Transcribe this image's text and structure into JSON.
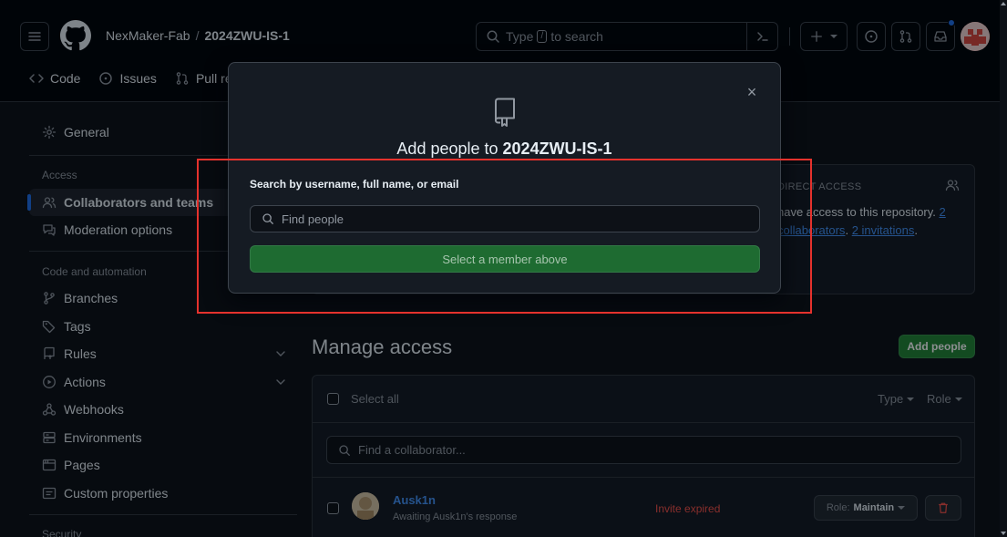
{
  "header": {
    "owner": "NexMaker-Fab",
    "separator": "/",
    "repo": "2024ZWU-IS-1",
    "search": {
      "prefix": "Type",
      "key": "/",
      "suffix": "to search"
    },
    "tabs": [
      {
        "label": "Code",
        "icon": "code-icon"
      },
      {
        "label": "Issues",
        "icon": "issue-icon"
      },
      {
        "label": "Pull re",
        "icon": "pull-request-icon"
      }
    ]
  },
  "sidebar": {
    "general": "General",
    "access_heading": "Access",
    "collaborators": "Collaborators and teams",
    "moderation": "Moderation options",
    "code_heading": "Code and automation",
    "branches": "Branches",
    "tags": "Tags",
    "rules": "Rules",
    "actions": "Actions",
    "webhooks": "Webhooks",
    "environments": "Environments",
    "pages": "Pages",
    "custom_properties": "Custom properties",
    "security_heading": "Security"
  },
  "direct_access": {
    "title": "DIRECT ACCESS",
    "line1_pre": "have access to this repository.",
    "line1_link": "2",
    "line2_link_a": "collaborators",
    "line2_sep": ".",
    "line2_link_b": "2 invitations",
    "line2_end": "."
  },
  "manage": {
    "title": "Manage access",
    "add_people": "Add people",
    "select_all": "Select all",
    "type_filter": "Type",
    "role_filter": "Role",
    "find_placeholder": "Find a collaborator...",
    "rows": [
      {
        "username": "Ausk1n",
        "subtitle": "Awaiting Ausk1n's response",
        "status": "Invite expired",
        "role_prefix": "Role:",
        "role": "Maintain"
      }
    ]
  },
  "modal": {
    "title_prefix": "Add people to",
    "title_repo": "2024ZWU-IS-1",
    "search_label": "Search by username, full name, or email",
    "search_placeholder": "Find people",
    "submit": "Select a member above",
    "close": "×"
  },
  "colors": {
    "accent": "#1f6feb",
    "green": "#238636",
    "danger": "#f85149",
    "highlight": "#e5322d"
  }
}
